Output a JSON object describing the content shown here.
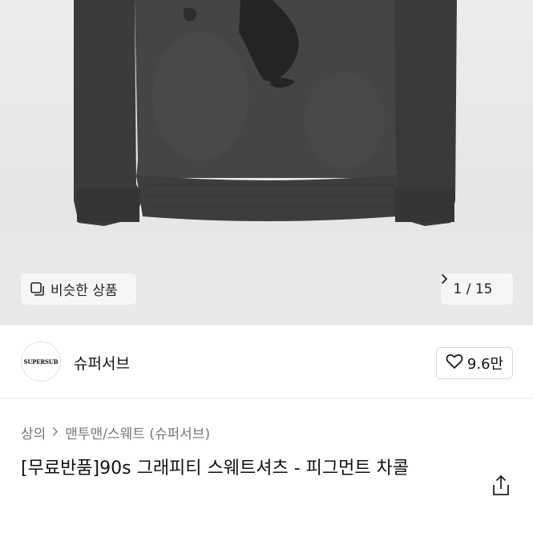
{
  "gallery": {
    "similar_label": "비슷한 상품",
    "counter": "1 / 15",
    "icons": {
      "similar": "similar-items-icon",
      "next": "chevron-right-icon"
    }
  },
  "brand": {
    "logo_text": "SUPERSUB",
    "name": "슈퍼서브",
    "likes": "9.6만",
    "icons": {
      "like": "heart-icon"
    }
  },
  "breadcrumb": {
    "items": [
      "상의",
      "맨투맨/스웨트 (슈퍼서브)"
    ]
  },
  "product": {
    "title": "[무료반품]90s 그래피티 스웨트셔츠 - 피그먼트 차콜",
    "icons": {
      "share": "share-icon"
    }
  }
}
